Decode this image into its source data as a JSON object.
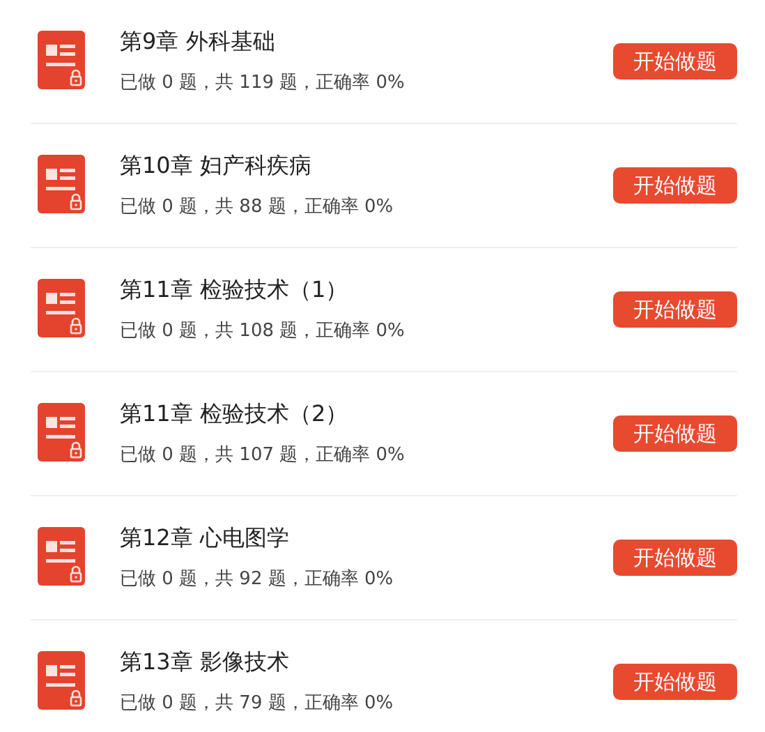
{
  "chapters": [
    {
      "title": "第9章 外科基础",
      "stats": "已做 0 题，共 119 题，正确率 0%",
      "locked": true,
      "button": "开始做题"
    },
    {
      "title": "第10章 妇产科疾病",
      "stats": "已做 0 题，共 88 题，正确率 0%",
      "locked": true,
      "button": "开始做题"
    },
    {
      "title": "第11章 检验技术（1）",
      "stats": "已做 0 题，共 108 题，正确率 0%",
      "locked": true,
      "button": "开始做题"
    },
    {
      "title": "第11章 检验技术（2）",
      "stats": "已做 0 题，共 107 题，正确率 0%",
      "locked": true,
      "button": "开始做题"
    },
    {
      "title": "第12章 心电图学",
      "stats": "已做 0 题，共 92 题，正确率 0%",
      "locked": true,
      "button": "开始做题"
    },
    {
      "title": "第13章 影像技术",
      "stats": "已做 0 题，共 79 题，正确率 0%",
      "locked": true,
      "button": "开始做题"
    }
  ]
}
